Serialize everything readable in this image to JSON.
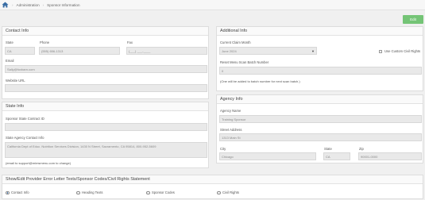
{
  "breadcrumb": {
    "items": [
      "Administration",
      "Sponsor Information"
    ]
  },
  "toolbar": {
    "edit_label": "Edit"
  },
  "contact": {
    "title": "Contact Info",
    "state_label": "State",
    "state_value": "CA",
    "phone_label": "Phone",
    "phone_value": "(555) 656-1313",
    "fax_label": "Fax",
    "fax_value": "(___) ___-____",
    "email_label": "Email",
    "email_value": "Sally@foxbarn.com",
    "website_label": "Website URL",
    "website_value": ""
  },
  "state_info": {
    "title": "State Info",
    "contract_id_label": "Sponsor State Contract ID",
    "contract_id_value": "",
    "agency_contact_label": "State Agency Contact Info",
    "agency_contact_value": "California Dept of Educ. Nutrition Services Division, 1430 N Street, Sacramento, CA 95814, 800-952-5609",
    "support_note": "(email to support@mimsmenu.com to change)"
  },
  "additional": {
    "title": "Additional Info",
    "claim_month_label": "Current Claim Month",
    "claim_month_value": "June 2024",
    "custom_civil_rights_label": "Use Custom Civil Rights",
    "reset_label": "Reset Menu Scan Batch Number",
    "reset_value": "0",
    "reset_note": "(One will be added to batch number for next scan batch.)"
  },
  "agency": {
    "title": "Agency Info",
    "name_label": "Agency Name",
    "name_value": "Training Sponsor",
    "street_label": "Street Address",
    "street_value": "1313 Main St",
    "city_label": "City",
    "city_value": "Chicago",
    "state_label": "State",
    "state_value": "CA",
    "zip_label": "Zip",
    "zip_value": "90001-0000"
  },
  "bottom": {
    "title": "Show/Edit Provider Error Letter Texts/Sponsor Codes/Civil Rights Statement",
    "options": [
      "Contact Info",
      "Heading Texts",
      "Sponsor Codes",
      "Civil Rights"
    ]
  }
}
